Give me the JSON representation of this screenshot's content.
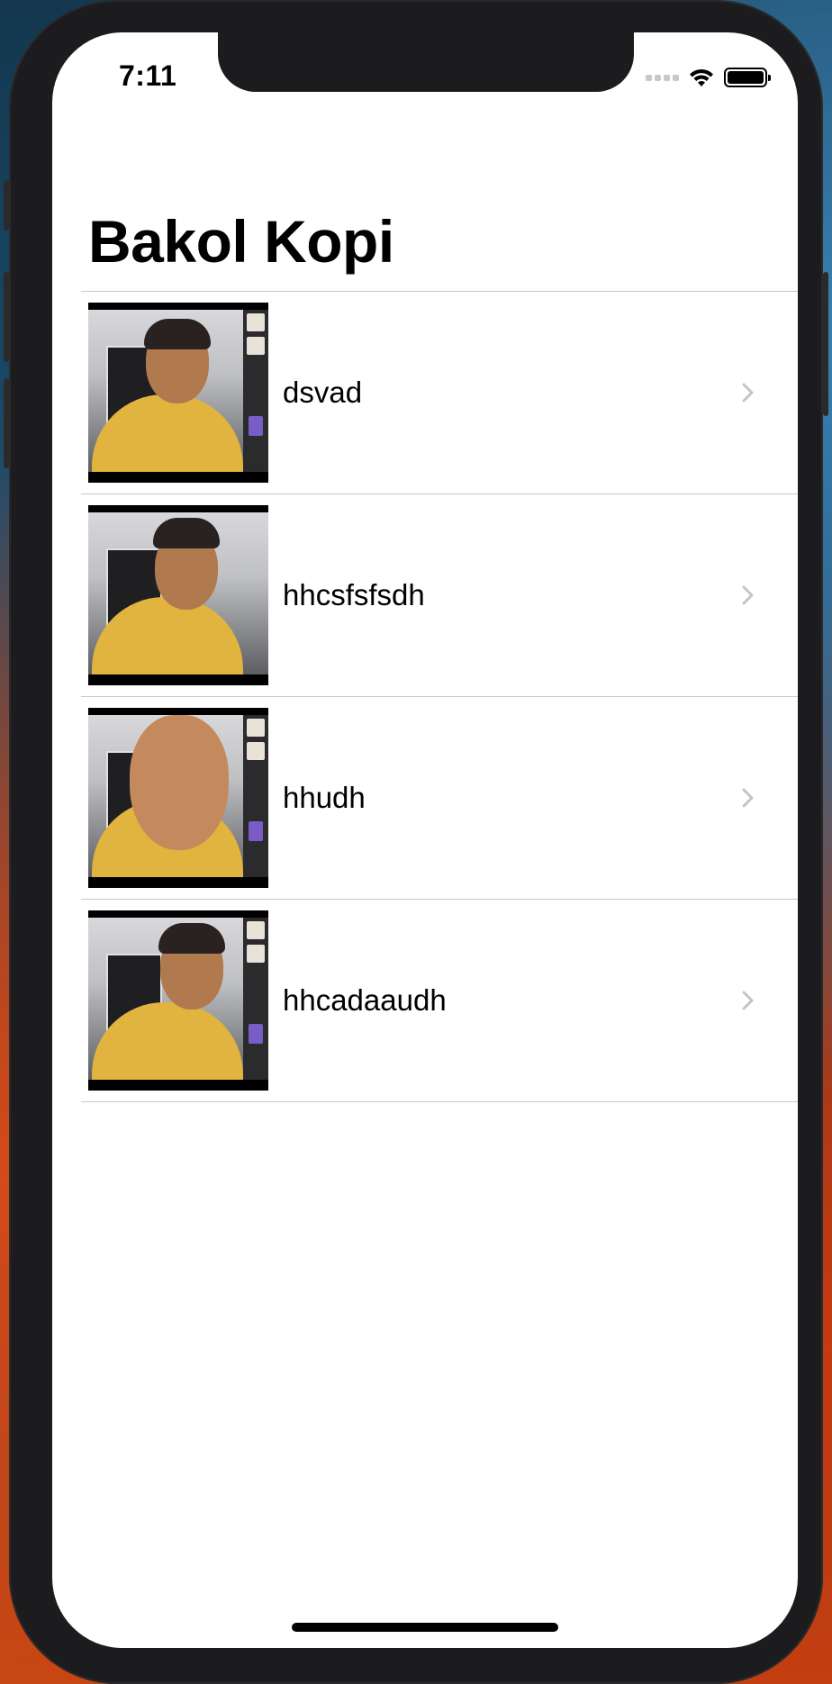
{
  "status_bar": {
    "time": "7:11"
  },
  "nav": {
    "title": "Bakol Kopi"
  },
  "list": {
    "items": [
      {
        "label": "dsvad"
      },
      {
        "label": "hhcsfsfsdh"
      },
      {
        "label": "hhudh"
      },
      {
        "label": "hhcadaaudh"
      }
    ]
  },
  "icons": {
    "status": [
      "cellular-signal-icon",
      "wifi-icon",
      "battery-icon"
    ],
    "row_accessory": "chevron-right-icon"
  },
  "colors": {
    "separator": "#c8c8cc",
    "chevron": "#c4c4c7",
    "background": "#ffffff"
  }
}
